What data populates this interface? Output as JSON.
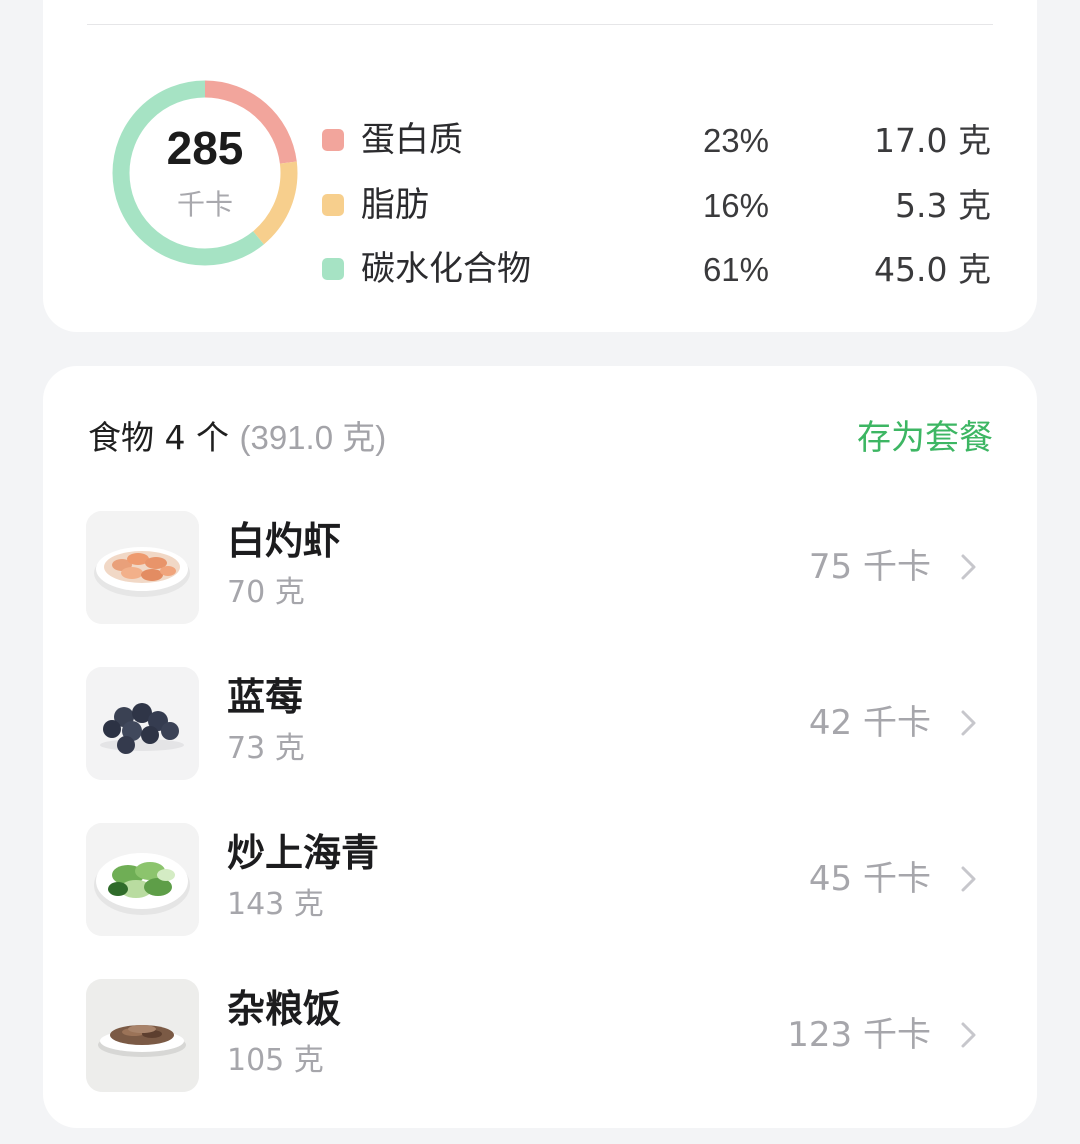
{
  "summary": {
    "calories": "285",
    "calorie_unit": "千卡",
    "macros": [
      {
        "name": "蛋白质",
        "percent": "23%",
        "grams": "17.0 克",
        "share": 0.23,
        "color": "#f2a59c"
      },
      {
        "name": "脂肪",
        "percent": "16%",
        "grams": "5.3 克",
        "share": 0.16,
        "color": "#f7cf8d"
      },
      {
        "name": "碳水化合物",
        "percent": "61%",
        "grams": "45.0 克",
        "share": 0.61,
        "color": "#a6e3c4"
      }
    ]
  },
  "foods": {
    "title": "食物 4 个",
    "total_weight": "(391.0 克)",
    "save_label": "存为套餐",
    "items": [
      {
        "name": "白灼虾",
        "weight": "70 克",
        "calories": "75 千卡",
        "image": "shrimp-plate"
      },
      {
        "name": "蓝莓",
        "weight": "73 克",
        "calories": "42 千卡",
        "image": "blueberries"
      },
      {
        "name": "炒上海青",
        "weight": "143 克",
        "calories": "45 千卡",
        "image": "bok-choy-plate"
      },
      {
        "name": "杂粮饭",
        "weight": "105 克",
        "calories": "123 千卡",
        "image": "grain-rice-plate"
      }
    ]
  }
}
